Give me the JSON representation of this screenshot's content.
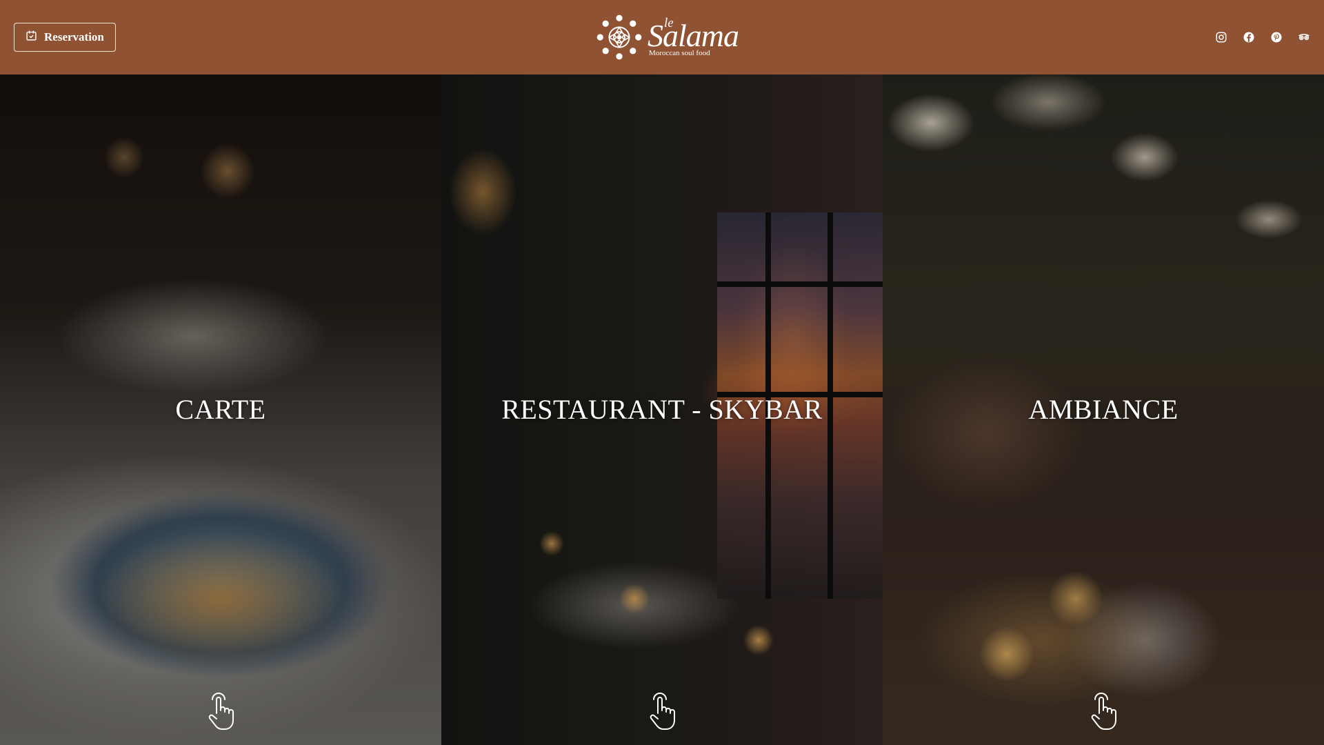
{
  "header": {
    "reservation_label": "Reservation",
    "logo": {
      "le": "le",
      "name": "Salama",
      "tagline": "Moroccan soul food"
    },
    "social": [
      "instagram-icon",
      "facebook-icon",
      "pinterest-icon",
      "tripadvisor-icon"
    ],
    "background_color": "#8f5334"
  },
  "panels": [
    {
      "title": "CARTE",
      "icon": "tap-hand-icon"
    },
    {
      "title": "RESTAURANT - SKYBAR",
      "icon": "tap-hand-icon"
    },
    {
      "title": "AMBIANCE",
      "icon": "tap-hand-icon"
    }
  ]
}
